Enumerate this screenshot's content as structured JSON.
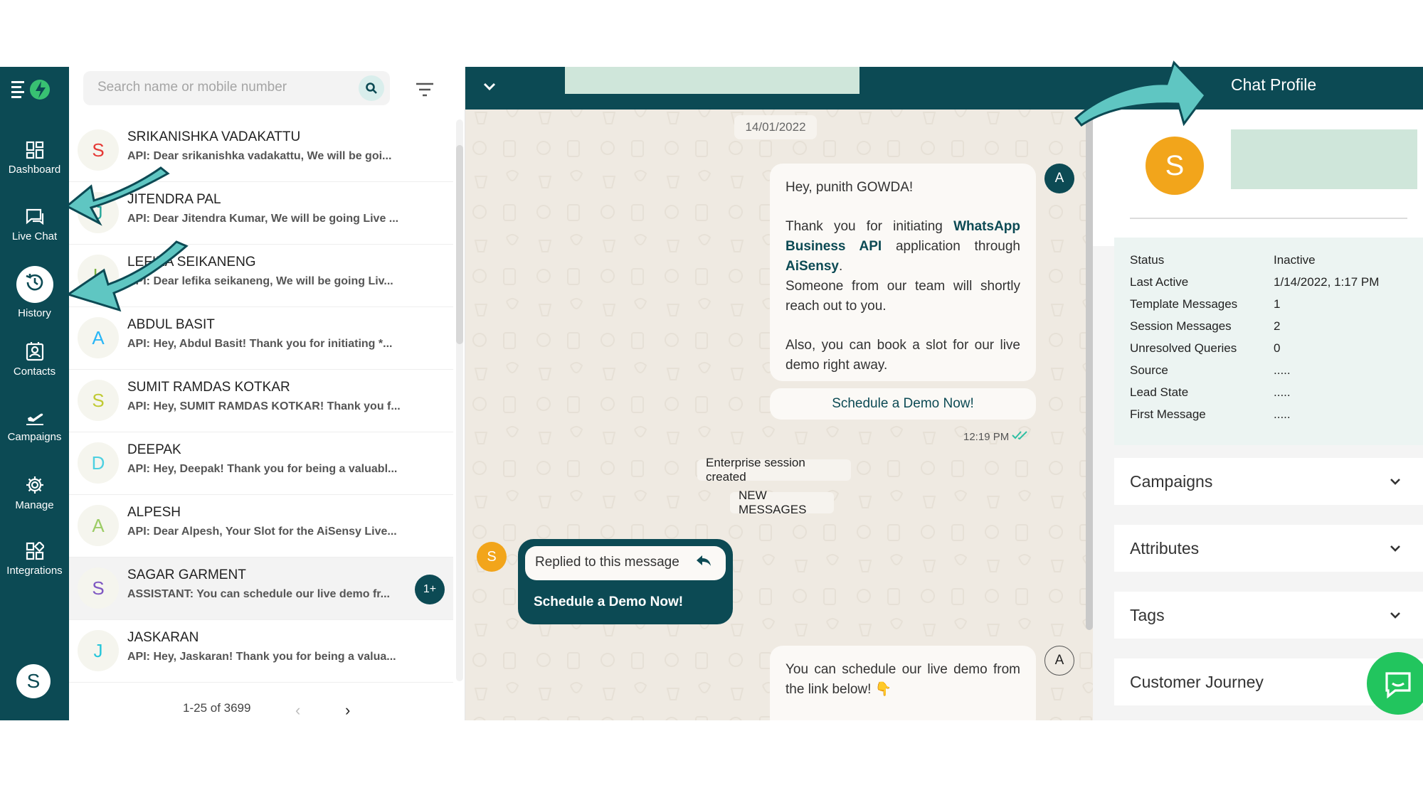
{
  "nav": {
    "items": [
      {
        "label": "Dashboard",
        "icon": "dashboard-icon"
      },
      {
        "label": "Live Chat",
        "icon": "chat-icon"
      },
      {
        "label": "History",
        "icon": "history-icon"
      },
      {
        "label": "Contacts",
        "icon": "contacts-icon"
      },
      {
        "label": "Campaigns",
        "icon": "campaigns-icon"
      },
      {
        "label": "Manage",
        "icon": "gear-icon"
      },
      {
        "label": "Integrations",
        "icon": "integrations-icon"
      }
    ],
    "active": "History",
    "user_initial": "S"
  },
  "search": {
    "placeholder": "Search name or mobile number"
  },
  "chats": [
    {
      "initial": "S",
      "name": "SRIKANISHKA VADAKATTU",
      "preview": "API: Dear srikanishka vadakattu, We will be goi...",
      "color": "#e53935"
    },
    {
      "initial": "J",
      "name": "JITENDRA PAL",
      "preview": "API: Dear Jitendra Kumar, We will be going Live ...",
      "color": "#26a69a"
    },
    {
      "initial": "L",
      "name": "LEFIKA SEIKANENG",
      "preview": "API: Dear lefika seikaneng, We will be going Liv...",
      "color": "#7cb342"
    },
    {
      "initial": "A",
      "name": "ABDUL BASIT",
      "preview": "API: Hey, Abdul Basit! Thank you for initiating *...",
      "color": "#29b6f6"
    },
    {
      "initial": "S",
      "name": "SUMIT RAMDAS KOTKAR",
      "preview": "API: Hey, SUMIT RAMDAS KOTKAR! Thank you f...",
      "color": "#c0ca33"
    },
    {
      "initial": "D",
      "name": "DEEPAK",
      "preview": "API: Hey, Deepak! Thank you for being a valuabl...",
      "color": "#4dd0e1"
    },
    {
      "initial": "A",
      "name": "ALPESH",
      "preview": "API: Dear Alpesh, Your Slot for the AiSensy Live...",
      "color": "#9ccc65"
    },
    {
      "initial": "S",
      "name": "SAGAR GARMENT",
      "preview": "ASSISTANT: You can schedule our live demo fr...",
      "color": "#7e57c2",
      "badge": "1+"
    },
    {
      "initial": "J",
      "name": "JASKARAN",
      "preview": "API: Hey, Jaskaran! Thank you for being a valua...",
      "color": "#26c6da"
    }
  ],
  "pagination": {
    "text": "1-25 of 3699",
    "prev": "‹",
    "next": "›"
  },
  "chat": {
    "date": "14/01/2022",
    "greeting": "Hey, punith GOWDA!",
    "thanks_prefix": "Thank you for initiating ",
    "brand_api": "WhatsApp Business API",
    "thanks_mid": " application through ",
    "brand": "AiSensy",
    "thanks_suffix": ".",
    "team": "Someone from our team will shortly reach out to you.",
    "book": "Also, you can book a slot for our live demo right away.",
    "cta": "Schedule a Demo Now!",
    "time": "12:19 PM",
    "agent_initial": "A",
    "system1": "Enterprise session created",
    "system2": "NEW MESSAGES",
    "customer_initial": "S",
    "reply_quote": "Replied to this message",
    "reply_text": "Schedule a Demo Now!",
    "last_message": "You can schedule our live demo from the link below! 👇"
  },
  "profile": {
    "title": "Chat Profile",
    "initial": "S",
    "fields": [
      {
        "key": "Status",
        "value": "Inactive"
      },
      {
        "key": "Last Active",
        "value": "1/14/2022, 1:17 PM"
      },
      {
        "key": "Template Messages",
        "value": "1"
      },
      {
        "key": "Session Messages",
        "value": "2"
      },
      {
        "key": "Unresolved Queries",
        "value": "0"
      },
      {
        "key": "Source",
        "value": "....."
      },
      {
        "key": "Lead State",
        "value": "....."
      },
      {
        "key": "First Message",
        "value": "....."
      }
    ],
    "sections": [
      "Campaigns",
      "Attributes",
      "Tags",
      "Customer Journey"
    ]
  },
  "colors": {
    "brand": "#0c4a54",
    "accent": "#f2a51b",
    "annotation": "#5fc6c2"
  }
}
